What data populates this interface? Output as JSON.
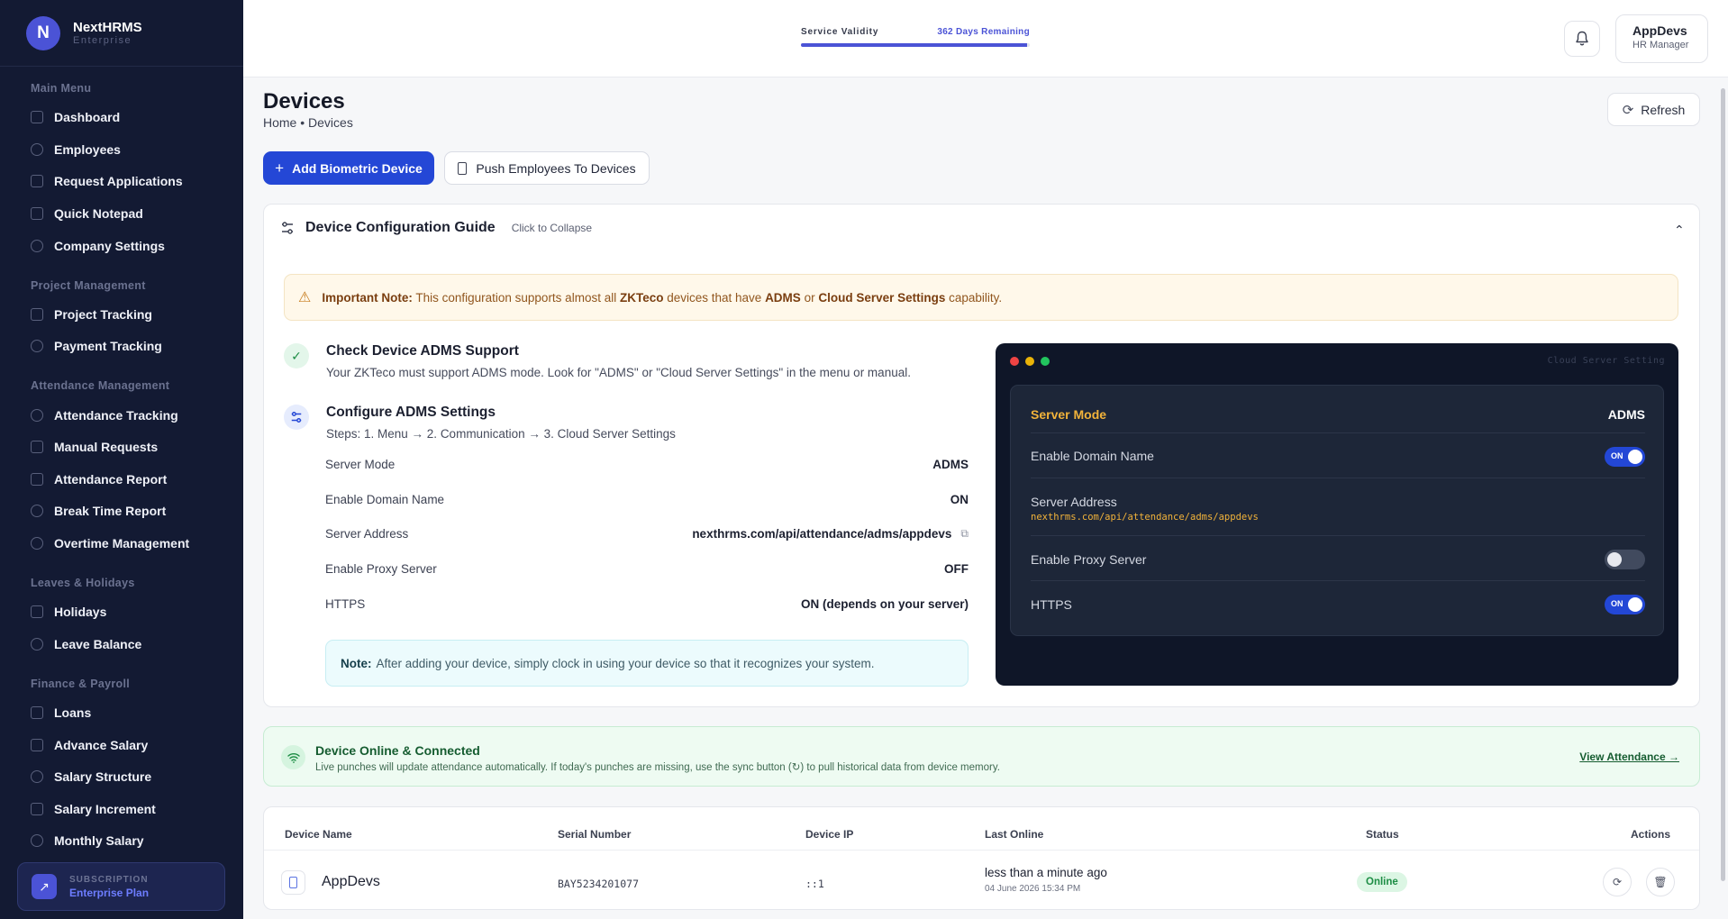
{
  "brand": {
    "logo_letter": "N",
    "name": "NextHRMS",
    "sub": "Enterprise"
  },
  "sidebar": {
    "sections": [
      {
        "title": "Main Menu",
        "items": [
          "Dashboard",
          "Employees",
          "Request Applications",
          "Quick Notepad",
          "Company Settings"
        ]
      },
      {
        "title": "Project Management",
        "items": [
          "Project Tracking",
          "Payment Tracking"
        ]
      },
      {
        "title": "Attendance Management",
        "items": [
          "Attendance Tracking",
          "Manual Requests",
          "Attendance Report",
          "Break Time Report",
          "Overtime Management"
        ]
      },
      {
        "title": "Leaves & Holidays",
        "items": [
          "Holidays",
          "Leave Balance"
        ]
      },
      {
        "title": "Finance & Payroll",
        "items": [
          "Loans",
          "Advance Salary",
          "Salary Structure",
          "Salary Increment",
          "Monthly Salary"
        ]
      }
    ],
    "subscription": {
      "label": "SUBSCRIPTION",
      "plan": "Enterprise Plan"
    }
  },
  "header": {
    "validity_label": "Service Validity",
    "validity_value": "362 Days Remaining",
    "validity_fraction": 0.99,
    "user_name": "AppDevs",
    "user_role": "HR Manager"
  },
  "page": {
    "title": "Devices",
    "breadcrumb": "Home • Devices",
    "refresh": "Refresh",
    "add_device": "Add Biometric Device",
    "push_employees": "Push Employees To Devices"
  },
  "guide": {
    "title": "Device Configuration Guide",
    "hint": "Click to Collapse",
    "note_label": "Important Note:",
    "note_p1": " This configuration supports almost all ",
    "note_b1": "ZKTeco",
    "note_p2": " devices that have ",
    "note_b2": "ADMS",
    "note_p3": " or ",
    "note_b3": "Cloud Server Settings",
    "note_p4": " capability.",
    "step1_title": "Check Device ADMS Support",
    "step1_desc": "Your ZKTeco must support ADMS mode. Look for \"ADMS\" or \"Cloud Server Settings\" in the menu or manual.",
    "step2_title": "Configure ADMS Settings",
    "step2_desc": "Steps: 1. Menu → 2. Communication → 3. Cloud Server Settings",
    "settings": [
      {
        "label": "Server Mode",
        "value": "ADMS"
      },
      {
        "label": "Enable Domain Name",
        "value": "ON"
      },
      {
        "label": "Server Address",
        "value": "nexthrms.com/api/attendance/adms/appdevs"
      },
      {
        "label": "Enable Proxy Server",
        "value": "OFF"
      },
      {
        "label": "HTTPS",
        "value": "ON (depends on your server)"
      }
    ],
    "inner_note_label": "Note:",
    "inner_note_text": "After adding your device, simply clock in using your device so that it recognizes your system."
  },
  "mock": {
    "caption": "Cloud Server Setting",
    "server_mode_label": "Server Mode",
    "server_mode_value": "ADMS",
    "domain_label": "Enable Domain Name",
    "address_label": "Server Address",
    "address_value": "nexthrms.com/api/attendance/adms/appdevs",
    "proxy_label": "Enable Proxy Server",
    "https_label": "HTTPS",
    "on_text": "ON"
  },
  "online": {
    "title": "Device Online & Connected",
    "desc": "Live punches will update attendance automatically. If today's punches are missing, use the sync button (↻) to pull historical data from device memory.",
    "link": "View Attendance →"
  },
  "table": {
    "headers": [
      "Device Name",
      "Serial Number",
      "Device IP",
      "Last Online",
      "Status",
      "Actions"
    ],
    "rows": [
      {
        "name": "AppDevs",
        "serial": "BAY5234201077",
        "ip": "::1",
        "last_online": "less than a minute ago",
        "last_online_date": "04 June 2026 15:34 PM",
        "status": "Online"
      }
    ]
  },
  "colors": {
    "sidebar_bg": "#131a33",
    "accent": "#2447d6",
    "brand": "#4b53d6",
    "online_green": "#1d8d45",
    "mock_orange": "#f2b33a"
  }
}
